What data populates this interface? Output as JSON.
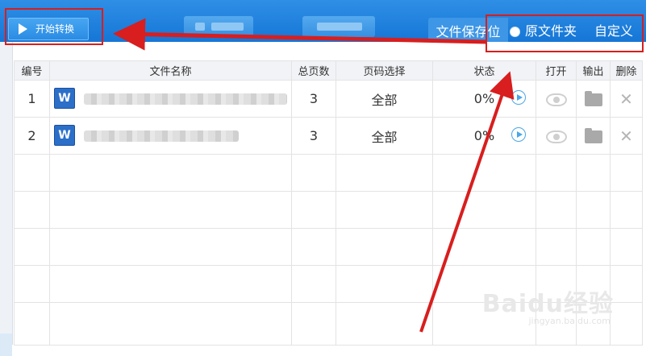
{
  "toolbar": {
    "start_label": "开始转换",
    "save_location_label": "文件保存位",
    "option_original": "原文件夹",
    "option_custom": "自定义"
  },
  "table": {
    "headers": [
      "编号",
      "文件名称",
      "总页数",
      "页码选择",
      "状态",
      "打开",
      "输出",
      "删除"
    ],
    "rows": [
      {
        "num": "1",
        "pages": "3",
        "selection": "全部",
        "status": "0%"
      },
      {
        "num": "2",
        "pages": "3",
        "selection": "全部",
        "status": "0%"
      }
    ]
  },
  "watermark": {
    "text": "Baidu经验",
    "url": "jingyan.baidu.com"
  },
  "colors": {
    "toolbar_blue": "#1f86e0",
    "annotation_red": "#d81e1e",
    "play_blue": "#4aa6ea"
  }
}
